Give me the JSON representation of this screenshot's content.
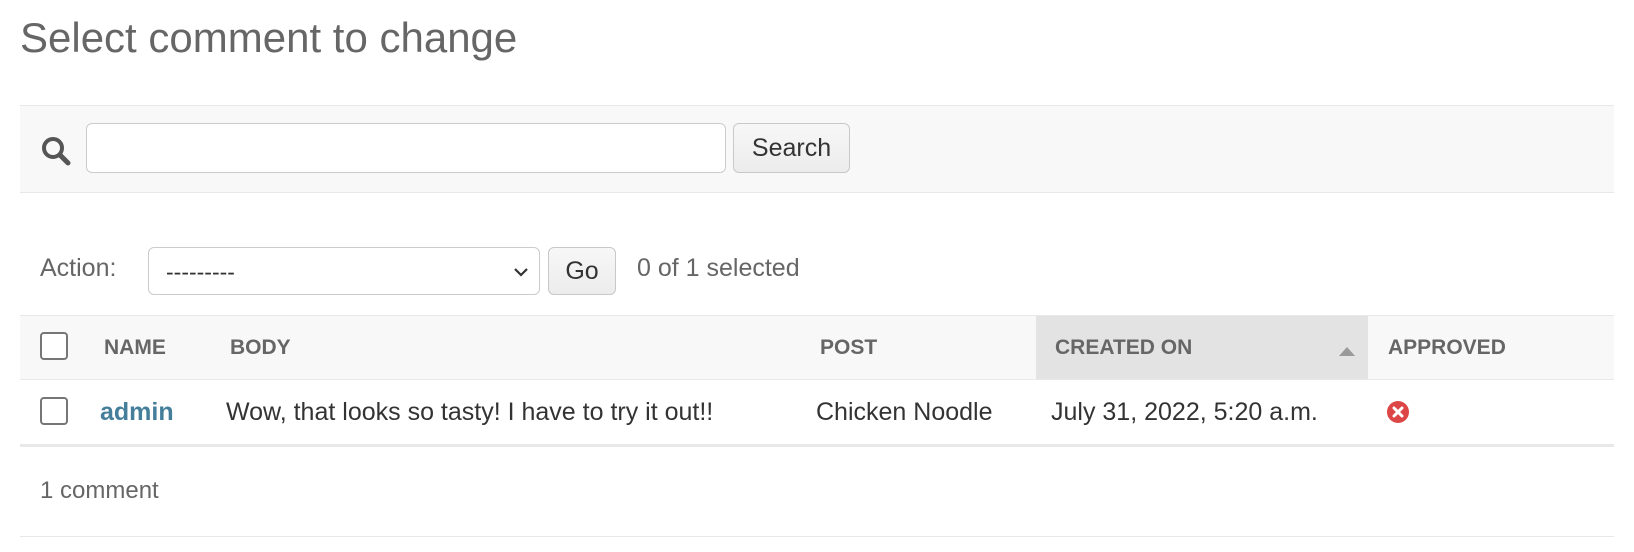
{
  "page": {
    "title": "Select comment to change"
  },
  "search": {
    "value": "",
    "placeholder": "",
    "button_label": "Search",
    "icon": "search-icon"
  },
  "actions": {
    "label": "Action:",
    "selected_option": "---------",
    "go_label": "Go",
    "selection_counter": "0 of 1 selected"
  },
  "table": {
    "columns": [
      "Name",
      "Body",
      "Post",
      "Created on",
      "Approved"
    ],
    "sorted_column": "Created on",
    "sort_direction": "ascending",
    "rows": [
      {
        "selected": false,
        "name": "admin",
        "body": "Wow, that looks so tasty! I have to try it out!!",
        "post": "Chicken Noodle",
        "created_on": "July 31, 2022, 5:20 a.m.",
        "approved": false,
        "approved_icon": "cross-circle-icon"
      }
    ]
  },
  "paginator": {
    "text": "1 comment"
  },
  "colors": {
    "link": "#447e9b",
    "approved_false": "#dd4646",
    "toolbar_bg": "#f8f8f8",
    "sorted_header_bg": "#e3e3e3"
  }
}
